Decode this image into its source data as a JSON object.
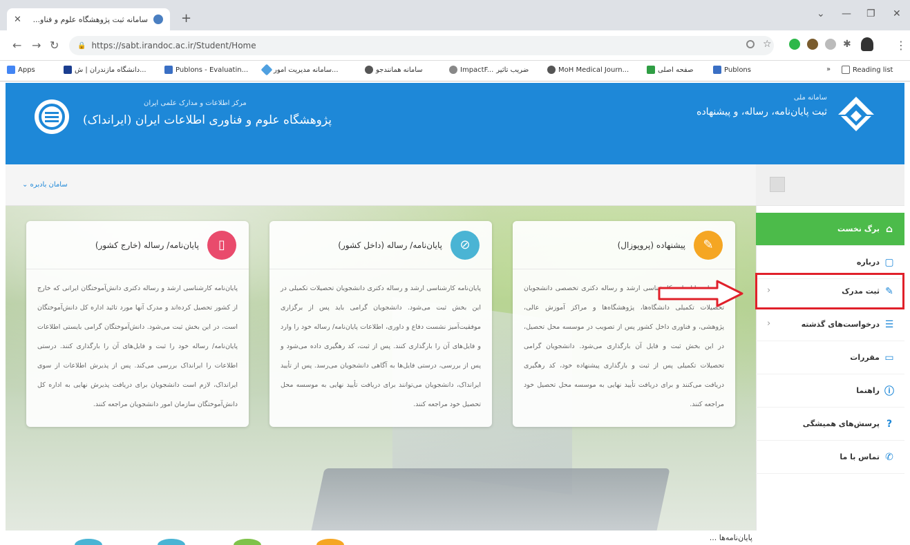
{
  "browser": {
    "tab_title": "سامانه ثبت پژوهشگاه علوم و فناو...",
    "url": "https://sabt.irandoc.ac.ir/Student/Home",
    "bookmarks": [
      {
        "label": "Apps",
        "color": "#4285f4"
      },
      {
        "label": "دانشگاه مازندران | ش...",
        "color": "#1a3d8f"
      },
      {
        "label": "Publons - Evaluatin...",
        "color": "#3a6fc4"
      },
      {
        "label": "سامانه مدیریت امور...",
        "color": "#4fa0e0"
      },
      {
        "label": "سامانه همانندجو",
        "color": "#555555"
      },
      {
        "label": "ImpactF...",
        "color": "#888888"
      },
      {
        "label": "ضریب تاثیر",
        "color": "#888888"
      },
      {
        "label": "MoH Medical Journ...",
        "color": "#555555"
      },
      {
        "label": "صفحه اصلی",
        "color": "#2f9e44"
      },
      {
        "label": "Publons",
        "color": "#3a6fc4"
      }
    ],
    "reading_list": "Reading list",
    "more": "»"
  },
  "header": {
    "org_sub": "مرکز اطلاعات و مدارک علمی ایران",
    "org_name": "پژوهشگاه علوم و فناوری اطلاعات ایران (ایرانداک)",
    "sys_sub": "سامانه ملی",
    "sys_name": "ثبت پایان‌نامه، رساله، و پیشنهاده",
    "user_menu": "سامان بادبره ⌄"
  },
  "cards": [
    {
      "title": "پیشنهاده (پروپوزال)",
      "color": "#f5a623",
      "icon": "edit-icon",
      "body": "پیشنهاده پایان‌نامه کارشناسی ارشد و رساله دکتری تخصصی دانشجویان تحصیلات تکمیلی دانشگاه‌ها، پژوهشگاه‌ها و مراکز آموزش عالی، پژوهشی، و فناوری داخل کشور پس از تصویب در موسسه محل تحصیل، در این بخش ثبت و فایل آن بارگذاری می‌شود. دانشجویان گرامی تحصیلات تکمیلی پس از ثبت و بارگذاری پیشنهاده خود، کد رهگیری دریافت می‌کنند و برای دریافت تأیید نهایی به موسسه محل تحصیل خود مراجعه کنند."
    },
    {
      "title": "پایان‌نامه/ رساله (داخل کشور)",
      "color": "#4ab4d4",
      "icon": "paperclip-icon",
      "body": "پایان‌نامه کارشناسی ارشد و رساله دکتری دانشجویان تحصیلات تکمیلی در این بخش ثبت می‌شود. دانشجویان گرامی باید پس از برگزاری موفقیت‌آمیز نشست دفاع و داوری، اطلاعات پایان‌نامه/ رساله خود را وارد و فایل‌های آن را بارگذاری کنند. پس از ثبت، کد رهگیری داده می‌شود و پس از بررسی، درستی فایل‌ها به آگاهی دانشجویان می‌رسد. پس از تأیید ایرانداک، دانشجویان می‌توانند برای دریافت تأیید نهایی به موسسه محل تحصیل خود مراجعه کنند."
    },
    {
      "title": "پایان‌نامه/ رساله (خارج کشور)",
      "color": "#e94b6c",
      "icon": "document-icon",
      "body": "پایان‌نامه کارشناسی ارشد و رساله دکتری دانش‌آموختگان ایرانی که خارج از کشور تحصیل کرده‌اند و مدرک آنها مورد تائید اداره کل دانش‌آموختگان است، در این بخش ثبت می‌شود. دانش‌آموختگان گرامی بایستی اطلاعات پایان‌نامه/ رساله خود را ثبت و فایل‌های آن را بارگذاری کنند. درستی اطلاعات را ایرانداک بررسی می‌کند. پس از پذیرش اطلاعات از سوی ایرانداک، لازم است دانشجویان برای دریافت پذیرش نهایی به اداره کل دانش‌آموختگان سازمان امور دانشجویان مراجعه کنند."
    }
  ],
  "sidebar": {
    "items": [
      {
        "label": "برگ نخست",
        "icon": "home-icon",
        "glyph": "⌂",
        "active": true,
        "chevron": ""
      },
      {
        "label": "درباره",
        "icon": "page-icon",
        "glyph": "▢",
        "active": false,
        "chevron": ""
      },
      {
        "label": "ثبت مدرک",
        "icon": "edit-icon",
        "glyph": "✎",
        "active": false,
        "chevron": "‹"
      },
      {
        "label": "درخواست‌های گذشته",
        "icon": "list-icon",
        "glyph": "☰",
        "active": false,
        "chevron": "‹"
      },
      {
        "label": "مقررات",
        "icon": "folder-icon",
        "glyph": "▭",
        "active": false,
        "chevron": ""
      },
      {
        "label": "راهنما",
        "icon": "info-icon",
        "glyph": "ⓘ",
        "active": false,
        "chevron": ""
      },
      {
        "label": "پرسش‌های همیشگی",
        "icon": "question-icon",
        "glyph": "?",
        "active": false,
        "chevron": ""
      },
      {
        "label": "تماس با ما",
        "icon": "phone-icon",
        "glyph": "✆",
        "active": false,
        "chevron": ""
      }
    ]
  },
  "bottom_text": "پایان‌نامه‌ها ..."
}
